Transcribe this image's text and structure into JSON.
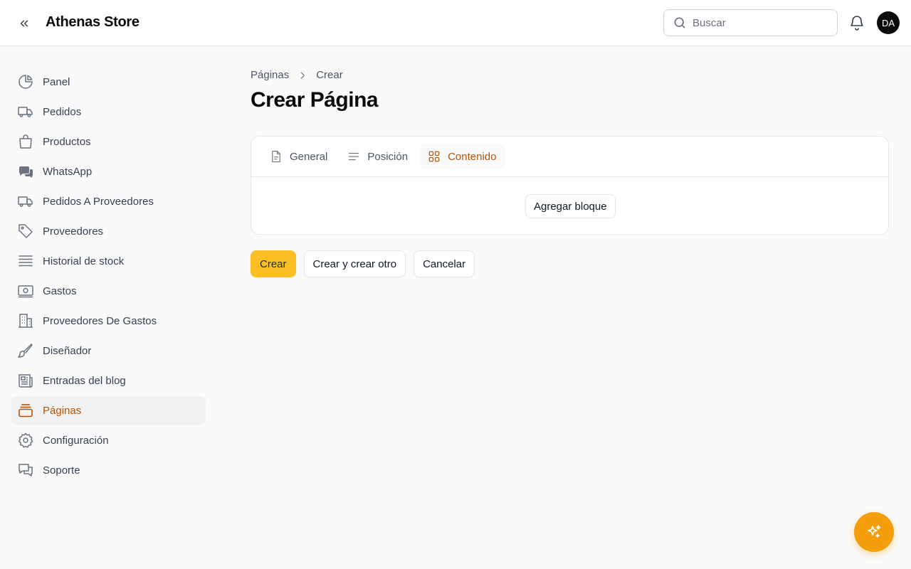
{
  "header": {
    "brand": "Athenas Store",
    "search_placeholder": "Buscar",
    "avatar_initials": "DA"
  },
  "sidebar": {
    "items": [
      {
        "label": "Panel",
        "icon": "pie-chart-icon"
      },
      {
        "label": "Pedidos",
        "icon": "truck-icon"
      },
      {
        "label": "Productos",
        "icon": "shopping-bag-icon"
      },
      {
        "label": "WhatsApp",
        "icon": "chat-bubbles-icon"
      },
      {
        "label": "Pedidos A Proveedores",
        "icon": "truck-icon"
      },
      {
        "label": "Proveedores",
        "icon": "tag-icon"
      },
      {
        "label": "Historial de stock",
        "icon": "stack-lines-icon"
      },
      {
        "label": "Gastos",
        "icon": "banknote-icon"
      },
      {
        "label": "Proveedores De Gastos",
        "icon": "building-icon"
      },
      {
        "label": "Diseñador",
        "icon": "paintbrush-icon"
      },
      {
        "label": "Entradas del blog",
        "icon": "newspaper-icon"
      },
      {
        "label": "Páginas",
        "icon": "rectangle-stack-icon",
        "active": true
      },
      {
        "label": "Configuración",
        "icon": "gear-icon"
      },
      {
        "label": "Soporte",
        "icon": "chat-support-icon"
      }
    ]
  },
  "breadcrumb": {
    "items": [
      "Páginas",
      "Crear"
    ]
  },
  "page": {
    "title": "Crear Página"
  },
  "tabs": [
    {
      "label": "General",
      "icon": "document-icon"
    },
    {
      "label": "Posición",
      "icon": "bars-icon"
    },
    {
      "label": "Contenido",
      "icon": "squares-icon",
      "active": true
    }
  ],
  "content": {
    "add_block_label": "Agregar bloque"
  },
  "actions": {
    "create": "Crear",
    "create_another": "Crear y crear otro",
    "cancel": "Cancelar"
  },
  "colors": {
    "accent": "#b45309",
    "primary_button": "#fbbf24",
    "fab": "#f59e0b"
  }
}
